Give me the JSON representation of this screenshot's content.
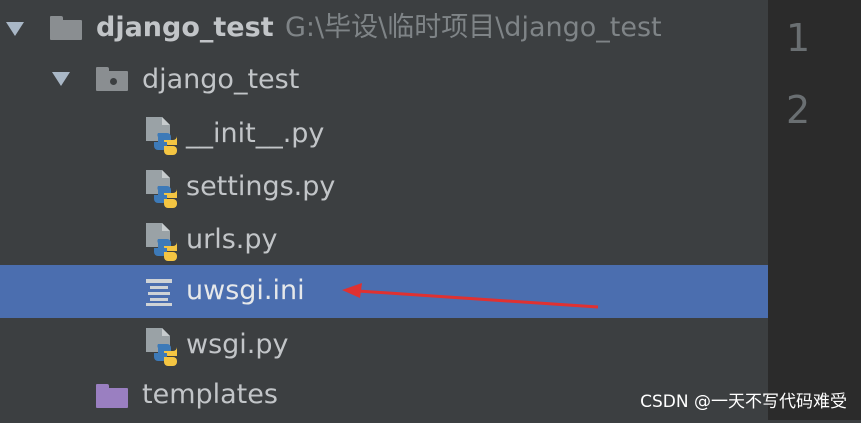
{
  "tree": {
    "project": {
      "name": "django_test",
      "path": "G:\\毕设\\临时项目\\django_test",
      "icon": "folder-icon"
    },
    "package": {
      "name": "django_test",
      "icon": "package-folder-icon"
    },
    "files": [
      {
        "name": "__init__.py",
        "icon": "python-file-icon"
      },
      {
        "name": "settings.py",
        "icon": "python-file-icon"
      },
      {
        "name": "urls.py",
        "icon": "python-file-icon"
      },
      {
        "name": "uwsgi.ini",
        "icon": "ini-file-icon",
        "selected": true
      },
      {
        "name": "wsgi.py",
        "icon": "python-file-icon"
      }
    ],
    "folder": {
      "name": "templates",
      "icon": "folder-icon",
      "color": "#9a7fc1"
    }
  },
  "gutter": {
    "line_numbers": [
      "1",
      "2"
    ]
  },
  "annotation": {
    "arrow_color": "#e03131",
    "target": "uwsgi.ini"
  },
  "watermark": "CSDN @一天不写代码难受",
  "colors": {
    "background": "#3c3f41",
    "selection": "#4b6eaf",
    "gutter": "#2b2b2b"
  }
}
